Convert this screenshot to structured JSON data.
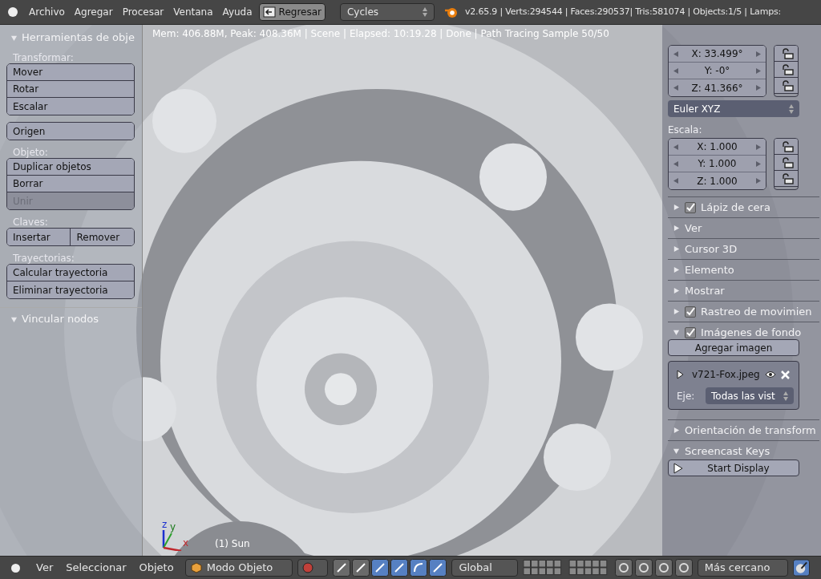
{
  "top_bar": {
    "menu": [
      "Archivo",
      "Agregar",
      "Procesar",
      "Ventana",
      "Ayuda"
    ],
    "back_button": "Regresar",
    "render_engine": "Cycles",
    "stats": "v2.65.9 | Verts:294544 | Faces:290537| Tris:581074 | Objects:1/5 | Lamps:"
  },
  "viewport": {
    "render_info": "Mem: 406.88M, Peak: 408.36M | Scene | Elapsed: 10:19.28 | Done | Path Tracing Sample 50/50",
    "axes": [
      "x",
      "y",
      "z"
    ],
    "object_label": "(1) Sun"
  },
  "tool_shelf": {
    "title": "Herramientas de obje",
    "expanded": true,
    "sections": [
      {
        "label": "Transformar:",
        "kind": "column",
        "buttons": [
          {
            "label": "Mover",
            "disabled": false
          },
          {
            "label": "Rotar",
            "disabled": false
          },
          {
            "label": "Escalar",
            "disabled": false
          }
        ]
      },
      {
        "kind": "column",
        "buttons": [
          {
            "label": "Origen",
            "disabled": false
          }
        ]
      },
      {
        "label": "Objeto:",
        "kind": "column",
        "buttons": [
          {
            "label": "Duplicar objetos",
            "disabled": false
          },
          {
            "label": "Borrar",
            "disabled": false
          },
          {
            "label": "Unir",
            "disabled": true
          }
        ]
      },
      {
        "label": "Claves:",
        "kind": "row",
        "buttons": [
          {
            "label": "Insertar",
            "disabled": false
          },
          {
            "label": "Remover",
            "disabled": false
          }
        ]
      },
      {
        "label": "Trayectorias:",
        "kind": "column",
        "buttons": [
          {
            "label": "Calcular trayectoria",
            "disabled": false
          },
          {
            "label": "Eliminar trayectoria",
            "disabled": false
          }
        ]
      }
    ],
    "next_panel": {
      "title": "Vincular nodos",
      "expanded": true
    }
  },
  "properties": {
    "rotation": [
      "X: 33.499°",
      "Y: -0°",
      "Z: 41.366°"
    ],
    "rotation_mode": "Euler XYZ",
    "scale_label": "Escala:",
    "scale": [
      "X: 1.000",
      "Y: 1.000",
      "Z: 1.000"
    ],
    "panels": [
      {
        "title": "Lápiz de cera",
        "kind": "checkbox",
        "checked": true,
        "expanded": false
      },
      {
        "title": "Ver",
        "kind": "plain",
        "expanded": false
      },
      {
        "title": "Cursor 3D",
        "kind": "plain",
        "expanded": false
      },
      {
        "title": "Elemento",
        "kind": "plain",
        "expanded": false
      },
      {
        "title": "Mostrar",
        "kind": "plain",
        "expanded": false
      },
      {
        "title": "Rastreo de movimien",
        "kind": "checkbox",
        "checked": true,
        "expanded": false
      },
      {
        "title": "Imágenes de fondo",
        "kind": "checkbox",
        "checked": true,
        "expanded": true
      }
    ],
    "background_images": {
      "add_button": "Agregar imagen",
      "image": "v721-Fox.jpeg",
      "axis_label": "Eje:",
      "axis_value": "Todas las vist"
    },
    "panels_after": [
      {
        "title": "Orientación de transform",
        "expanded": false
      },
      {
        "title": "Screencast Keys",
        "expanded": true
      }
    ],
    "start_button": "Start Display"
  },
  "bottom_bar": {
    "menu": [
      "Ver",
      "Seleccionar",
      "Objeto"
    ],
    "mode": "Modo Objeto",
    "orientation": "Global",
    "snap": "Más cercano"
  }
}
